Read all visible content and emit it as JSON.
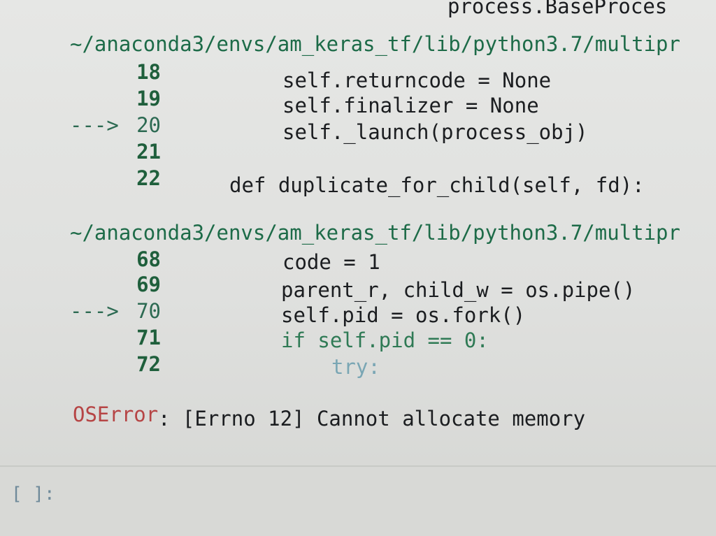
{
  "top_fragment": "process.BaseProces",
  "blocks": [
    {
      "path": "~/anaconda3/envs/am_keras_tf/lib/python3.7/multipr",
      "lines": [
        {
          "arrow": "",
          "num": "18",
          "code": "self.returncode = None"
        },
        {
          "arrow": "",
          "num": "19",
          "code": "self.finalizer = None"
        },
        {
          "arrow": "--->",
          "num": "20",
          "code": "self._launch(process_obj)"
        },
        {
          "arrow": "",
          "num": "21",
          "code": ""
        },
        {
          "arrow": "",
          "num": "22",
          "code": "def duplicate_for_child(self, fd):"
        }
      ]
    },
    {
      "path": "~/anaconda3/envs/am_keras_tf/lib/python3.7/multipr",
      "lines": [
        {
          "arrow": "",
          "num": "68",
          "code": "code = 1"
        },
        {
          "arrow": "",
          "num": "69",
          "code": "parent_r, child_w = os.pipe()"
        },
        {
          "arrow": "--->",
          "num": "70",
          "code": "self.pid = os.fork()"
        },
        {
          "arrow": "",
          "num": "71",
          "code": "if self.pid == 0:"
        },
        {
          "arrow": "",
          "num": "72",
          "code": "try:"
        }
      ]
    }
  ],
  "error": {
    "type": "OSError",
    "message": ": [Errno 12] Cannot allocate memory"
  },
  "prompt": "[ ]:"
}
